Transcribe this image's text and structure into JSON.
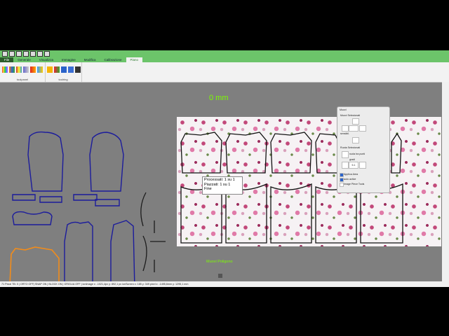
{
  "ribbon_tabs": [
    "File",
    "Generale",
    "Visualizza",
    "Immagine",
    "Modifica",
    "Calibrazione",
    "Piano"
  ],
  "ribbon_groups": [
    {
      "label": "toolpanel"
    },
    {
      "label": "toolring"
    }
  ],
  "canvas": {
    "measurement": "0 mm",
    "move_label": "Muovi Poligono",
    "processing_lines": [
      "Processati: 1 su 1",
      "Piazzati: 1 su 1",
      "Fine"
    ]
  },
  "panel": {
    "title": "Muovi",
    "section1": "Muovi Selezionati",
    "step_label": "sensibil.",
    "section2": "Ruota Selezionati",
    "rotate_option": "ruota tra punti",
    "angle_label": "gradi",
    "angle_value": "5.1",
    "checkbox1": "Applica Area",
    "checkbox2": "auto active",
    "checkbox3": "Image Piece Tools"
  },
  "statusbar": {
    "text": "71 Pezzi TB: 0   | ORTO OFF| SNAP ON | BLOCK ON | GRIGLIA OFF |   ionImage x: -1021,4px y: 892,1 px  ionScreen x: 185 y: 349 pixel  x: -1495,6mm y: 1295,1 mm"
  },
  "colors": {
    "title_green": "#6cc46a",
    "active_tab_text": "#2e7d32",
    "canvas_bg": "#7f7f7f",
    "piece_outline": "#1c1c9c",
    "selected_piece": "#f28c1a",
    "guide_text": "#7CFC00"
  }
}
